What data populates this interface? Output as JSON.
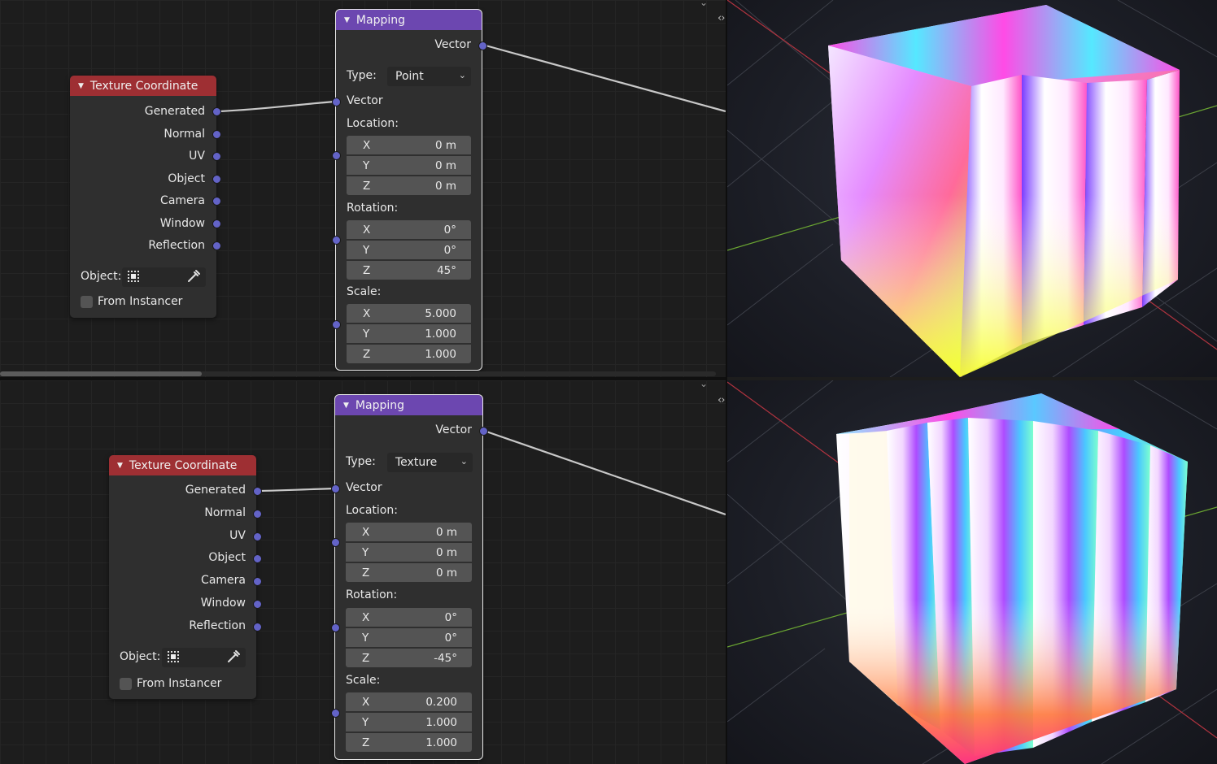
{
  "top": {
    "texcoord": {
      "title": "Texture Coordinate",
      "outputs": [
        "Generated",
        "Normal",
        "UV",
        "Object",
        "Camera",
        "Window",
        "Reflection"
      ],
      "object_label": "Object:",
      "from_instancer": "From Instancer"
    },
    "mapping": {
      "title": "Mapping",
      "output": "Vector",
      "type_label": "Type:",
      "type_value": "Point",
      "vector_label": "Vector",
      "location_label": "Location:",
      "location": [
        {
          "axis": "X",
          "value": "0 m"
        },
        {
          "axis": "Y",
          "value": "0 m"
        },
        {
          "axis": "Z",
          "value": "0 m"
        }
      ],
      "rotation_label": "Rotation:",
      "rotation": [
        {
          "axis": "X",
          "value": "0°"
        },
        {
          "axis": "Y",
          "value": "0°"
        },
        {
          "axis": "Z",
          "value": "45°"
        }
      ],
      "scale_label": "Scale:",
      "scale": [
        {
          "axis": "X",
          "value": "5.000"
        },
        {
          "axis": "Y",
          "value": "1.000"
        },
        {
          "axis": "Z",
          "value": "1.000"
        }
      ]
    }
  },
  "bottom": {
    "texcoord": {
      "title": "Texture Coordinate",
      "outputs": [
        "Generated",
        "Normal",
        "UV",
        "Object",
        "Camera",
        "Window",
        "Reflection"
      ],
      "object_label": "Object:",
      "from_instancer": "From Instancer"
    },
    "mapping": {
      "title": "Mapping",
      "output": "Vector",
      "type_label": "Type:",
      "type_value": "Texture",
      "vector_label": "Vector",
      "location_label": "Location:",
      "location": [
        {
          "axis": "X",
          "value": "0 m"
        },
        {
          "axis": "Y",
          "value": "0 m"
        },
        {
          "axis": "Z",
          "value": "0 m"
        }
      ],
      "rotation_label": "Rotation:",
      "rotation": [
        {
          "axis": "X",
          "value": "0°"
        },
        {
          "axis": "Y",
          "value": "0°"
        },
        {
          "axis": "Z",
          "value": "-45°"
        }
      ],
      "scale_label": "Scale:",
      "scale": [
        {
          "axis": "X",
          "value": "0.200"
        },
        {
          "axis": "Y",
          "value": "1.000"
        },
        {
          "axis": "Z",
          "value": "1.000"
        }
      ]
    }
  },
  "icons": {
    "collapse": "triangle-down-icon",
    "dropdown": "chevron-down-icon",
    "object": "object-icon",
    "eyedropper": "eyedropper-icon",
    "area_split": "area-arrows-icon"
  },
  "colors": {
    "texcoord_header": "#9e2f33",
    "mapping_header": "#6c47b0",
    "socket_vector": "#6363c7",
    "node_body": "#2f2f2f",
    "editor_bg": "#1d1d1d"
  }
}
